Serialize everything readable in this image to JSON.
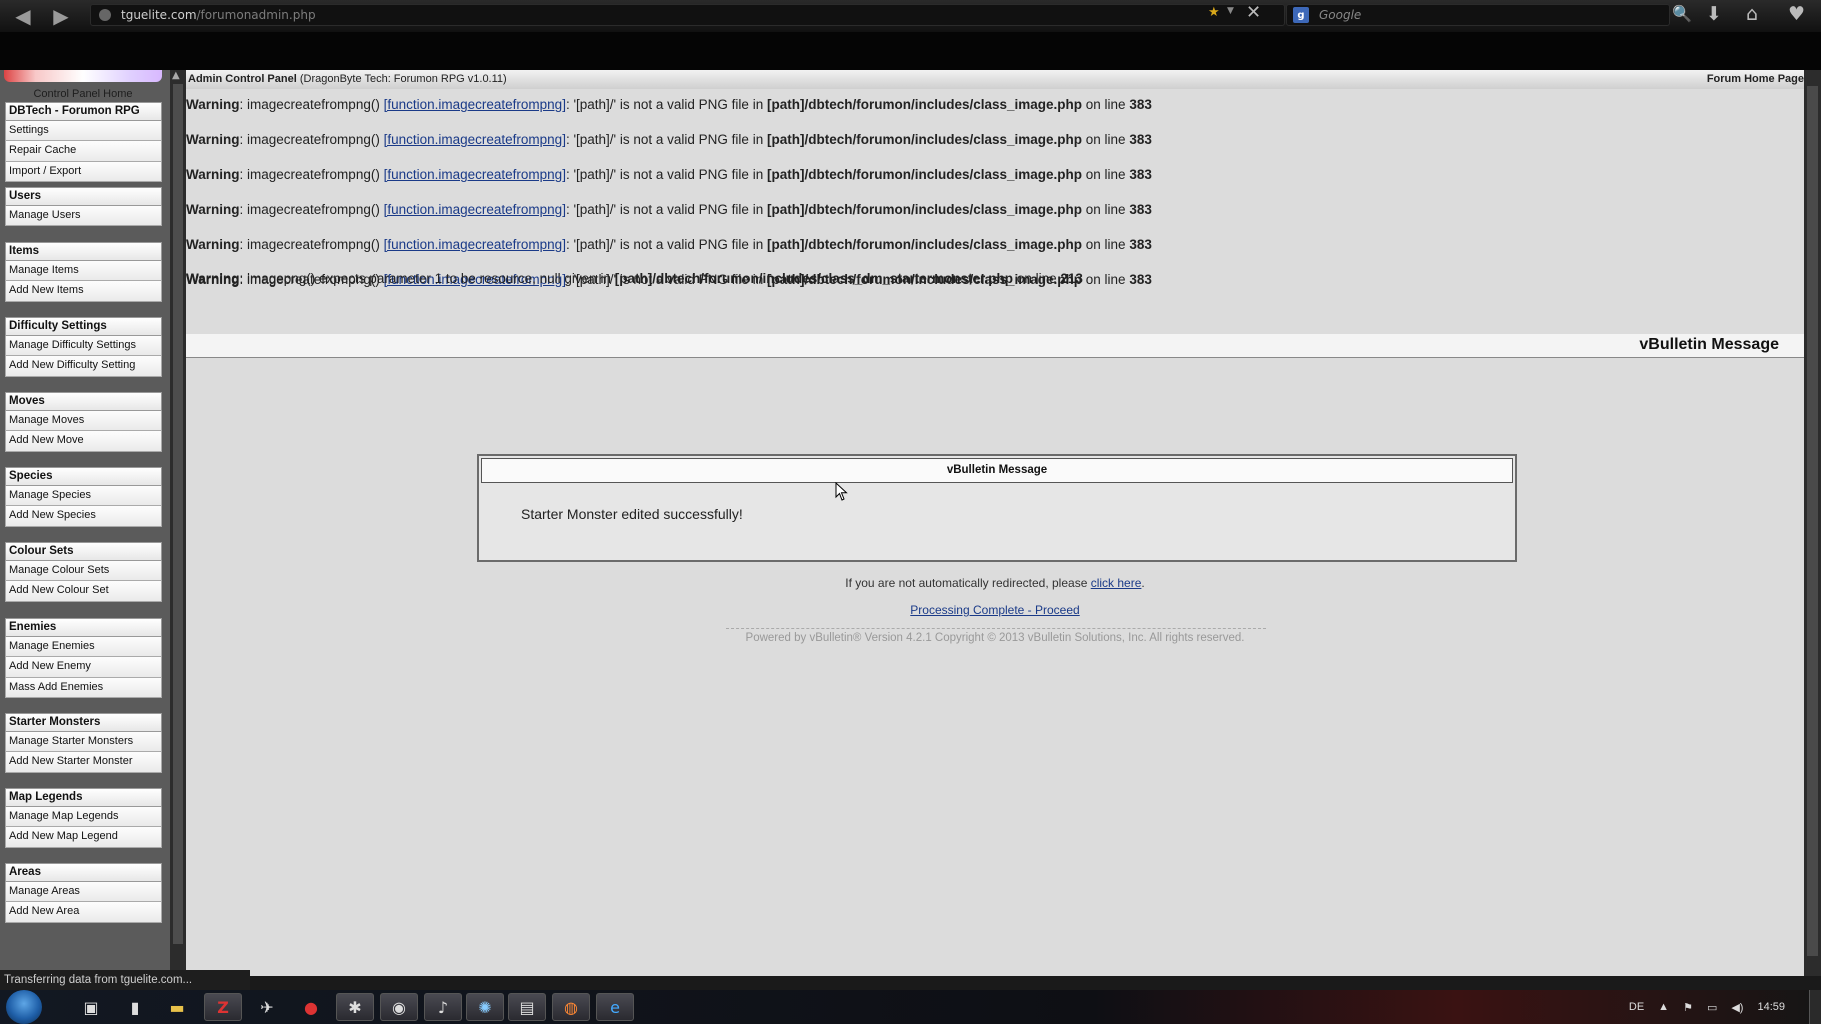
{
  "browser": {
    "url_host": "tguelite.com",
    "url_path": "/forumonadmin.php",
    "search_placeholder": "Google"
  },
  "sidebar": {
    "home_label": "Control Panel Home",
    "groups": [
      {
        "title": "DBTech - Forumon RPG",
        "items": [
          "Settings",
          "Repair Cache",
          "Import / Export"
        ]
      },
      {
        "title": "Users",
        "items": [
          "Manage Users"
        ]
      },
      {
        "title": "Items",
        "items": [
          "Manage Items",
          "Add New Items"
        ]
      },
      {
        "title": "Difficulty Settings",
        "items": [
          "Manage Difficulty Settings",
          "Add New Difficulty Setting"
        ]
      },
      {
        "title": "Moves",
        "items": [
          "Manage Moves",
          "Add New Move"
        ]
      },
      {
        "title": "Species",
        "items": [
          "Manage Species",
          "Add New Species"
        ]
      },
      {
        "title": "Colour Sets",
        "items": [
          "Manage Colour Sets",
          "Add New Colour Set"
        ]
      },
      {
        "title": "Enemies",
        "items": [
          "Manage Enemies",
          "Add New Enemy",
          "Mass Add Enemies"
        ]
      },
      {
        "title": "Starter Monsters",
        "items": [
          "Manage Starter Monsters",
          "Add New Starter Monster"
        ]
      },
      {
        "title": "Map Legends",
        "items": [
          "Manage Map Legends",
          "Add New Map Legend"
        ]
      },
      {
        "title": "Areas",
        "items": [
          "Manage Areas",
          "Add New Area"
        ]
      }
    ]
  },
  "header": {
    "title_bold": "Admin Control Panel",
    "title_rest": "(DragonByte Tech: Forumon RPG v1.0.11)",
    "forum_home": "Forum Home Page"
  },
  "warnings": [
    {
      "label": "Warning",
      "func": "imagecreatefrompng()",
      "link": "[function.imagecreatefrompng]",
      "msg": ": '[path]/' is not a valid PNG file in",
      "file": "[path]/dbtech/forumon/includes/class_image.php",
      "on": "on line",
      "line": "383"
    },
    {
      "label": "Warning",
      "func": "imagecreatefrompng()",
      "link": "[function.imagecreatefrompng]",
      "msg": ": '[path]/' is not a valid PNG file in",
      "file": "[path]/dbtech/forumon/includes/class_image.php",
      "on": "on line",
      "line": "383"
    },
    {
      "label": "Warning",
      "func": "imagecreatefrompng()",
      "link": "[function.imagecreatefrompng]",
      "msg": ": '[path]/' is not a valid PNG file in",
      "file": "[path]/dbtech/forumon/includes/class_image.php",
      "on": "on line",
      "line": "383"
    },
    {
      "label": "Warning",
      "func": "imagecreatefrompng()",
      "link": "[function.imagecreatefrompng]",
      "msg": ": '[path]/' is not a valid PNG file in",
      "file": "[path]/dbtech/forumon/includes/class_image.php",
      "on": "on line",
      "line": "383"
    },
    {
      "label": "Warning",
      "func": "imagecreatefrompng()",
      "link": "[function.imagecreatefrompng]",
      "msg": ": '[path]/' is not a valid PNG file in",
      "file": "[path]/dbtech/forumon/includes/class_image.php",
      "on": "on line",
      "line": "383"
    },
    {
      "label": "Warning",
      "func": "imagecreatefrompng()",
      "link": "[function.imagecreatefrompng]",
      "msg": ": '[path]/' is not a valid PNG file in",
      "file": "[path]/dbtech/forumon/includes/class_image.php",
      "on": "on line",
      "line": "383"
    }
  ],
  "warning_last": {
    "label": "Warning",
    "msg": ": imagepng() expects parameter 1 to be resource, null given in",
    "file": "[path]/dbtech/forumon/includes/class_dm_startermonster.php",
    "on": "on line",
    "line": "213"
  },
  "message": {
    "top_title": "vBulletin Message",
    "box_title": "vBulletin Message",
    "body": "Starter Monster edited successfully!",
    "redirect_text": "If you are not automatically redirected, please",
    "redirect_link": "click here",
    "redirect_end": ".",
    "proceed": "Processing Complete - Proceed",
    "footer": "Powered by vBulletin® Version 4.2.1 Copyright © 2013 vBulletin Solutions, Inc. All rights reserved."
  },
  "status": {
    "text": "Transferring data from tguelite.com..."
  },
  "taskbar": {
    "lang": "DE",
    "time": "14:59"
  },
  "icons": {
    "back": "back-arrow-icon",
    "forward": "forward-arrow-icon",
    "star": "bookmark-star-icon",
    "stop": "close-icon",
    "search": "search-icon",
    "download": "download-icon",
    "home": "home-icon"
  }
}
